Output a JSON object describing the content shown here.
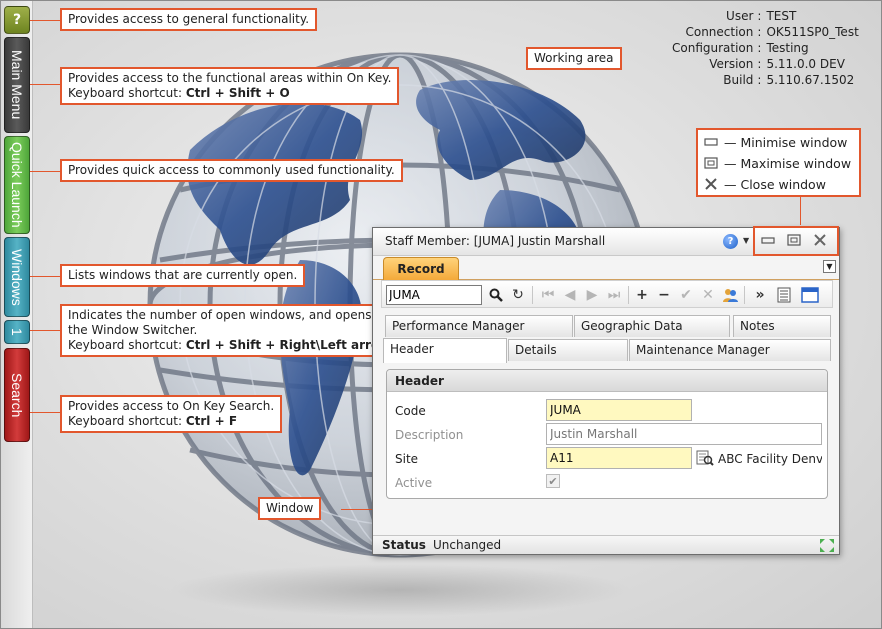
{
  "sidebar": {
    "help_label": "?",
    "main_menu_label": "Main Menu",
    "quick_launch_label": "Quick Launch",
    "windows_label": "Windows",
    "window_count": "1",
    "search_label": "Search"
  },
  "info": {
    "user_label": "User",
    "user_value": "TEST",
    "connection_label": "Connection",
    "connection_value": "OK511SP0_Test",
    "configuration_label": "Configuration",
    "configuration_value": "Testing",
    "version_label": "Version",
    "version_value": "5.11.0.0 DEV",
    "build_label": "Build",
    "build_value": "5.110.67.1502",
    "separator": ":"
  },
  "callouts": {
    "general": "Provides access to general functionality.",
    "main_menu_line1": "Provides access to the functional areas within On Key.",
    "main_menu_line2_prefix": "Keyboard shortcut: ",
    "main_menu_line2_keys": "Ctrl + Shift + O",
    "quick_launch": "Provides quick access to commonly used functionality.",
    "windows": "Lists windows that are currently open.",
    "count_line1": "Indicates the number of open windows, and opens",
    "count_line2": "the Window Switcher.",
    "count_line3_prefix": "Keyboard shortcut: ",
    "count_line3_keys": "Ctrl + Shift + Right\\Left arrow",
    "search_line1": "Provides access to On Key Search.",
    "search_line2_prefix": "Keyboard shortcut: ",
    "search_line2_keys": "Ctrl + F",
    "working_area": "Working area",
    "window": "Window"
  },
  "legend": {
    "minimise": "— Minimise window",
    "maximise": "— Maximise window",
    "close": "— Close window"
  },
  "window": {
    "title": "Staff Member: [JUMA] Justin Marshall",
    "tab_record": "Record",
    "search_value": "JUMA",
    "page_tabs_row1": [
      "Performance Manager",
      "Geographic Data",
      "Notes"
    ],
    "page_tabs_row2": [
      "Header",
      "Details",
      "Maintenance Manager"
    ],
    "panel_title": "Header",
    "fields": {
      "code_label": "Code",
      "code_value": "JUMA",
      "description_label": "Description",
      "description_value": "Justin Marshall",
      "site_label": "Site",
      "site_value": "A11",
      "site_description": "ABC Facility Denve",
      "active_label": "Active"
    },
    "status_label": "Status",
    "status_value": "Unchanged"
  },
  "colors": {
    "callout_border": "#e2572d",
    "record_tab": "#f4a93a",
    "required_field": "#fff9c0"
  }
}
